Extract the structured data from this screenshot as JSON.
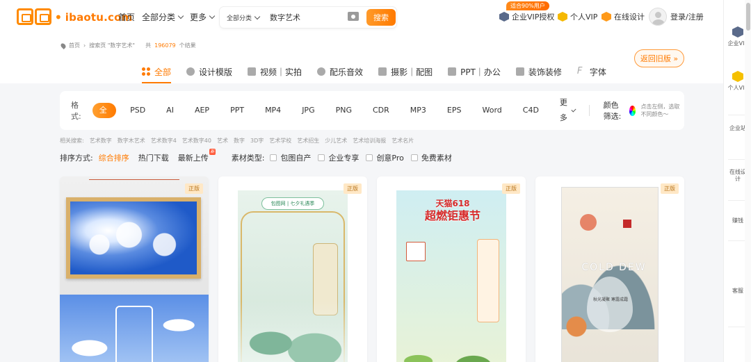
{
  "header": {
    "logo_text": "ibaotu.com",
    "nav": [
      "首页",
      "全部分类",
      "更多"
    ],
    "search_category": "全部分类",
    "search_value": "数字艺术",
    "search_button": "搜索",
    "promo": "适合90%用户",
    "enterprise_vip": "企业VIP授权",
    "personal_vip": "个人VIP",
    "online_design": "在线设计",
    "login": "登录/注册"
  },
  "breadcrumb": {
    "home": "首页",
    "search_page": "搜索页 \"数字艺术\"",
    "prefix": "共",
    "count": "196079",
    "suffix": "个结果"
  },
  "tabs": [
    {
      "label": "全部"
    },
    {
      "label": "设计模版"
    },
    {
      "label": "视频｜实拍"
    },
    {
      "label": "配乐音效"
    },
    {
      "label": "摄影｜配图"
    },
    {
      "label": "PPT｜办公"
    },
    {
      "label": "装饰装修"
    },
    {
      "label": "字体"
    }
  ],
  "old_version_button": "返回旧版 »",
  "filter": {
    "label": "格式:",
    "formats": [
      "全部",
      "PSD",
      "AI",
      "AEP",
      "PPT",
      "MP4",
      "JPG",
      "PNG",
      "CDR",
      "MP3",
      "EPS",
      "Word",
      "C4D",
      "更多"
    ],
    "color_label": "颜色筛选:",
    "color_hint": "点击左侧，选取不同颜色～"
  },
  "related": {
    "label": "相关搜索:",
    "items": [
      "艺术数字",
      "数字木艺术",
      "艺术数字4",
      "艺术数字40",
      "艺术",
      "数字",
      "3D字",
      "艺术学校",
      "艺术招生",
      "少儿艺术",
      "艺术培训海报",
      "艺术名片"
    ]
  },
  "sort": {
    "label": "排序方式:",
    "options": [
      "综合排序",
      "热门下载",
      "最新上传"
    ],
    "new_badge": "新",
    "type_label": "素材类型:",
    "types": [
      "包图自产",
      "企业专享",
      "创意Pro",
      "免费素材"
    ]
  },
  "cards": [
    {
      "badge": "正版"
    },
    {
      "badge": "正版",
      "art_title": "包图网 | 七夕礼遇季"
    },
    {
      "badge": "正版",
      "art_title_line1": "天猫618",
      "art_title_line2": "超燃钜惠节"
    },
    {
      "badge": "正版",
      "art_title": "COLD DEW",
      "art_subtitle": "秋光凝聚 寒露成霜"
    }
  ],
  "sidebar": {
    "items": [
      "企业VIP",
      "个人VIP",
      "企业站",
      "在线设计",
      "赚钱",
      "客服"
    ]
  },
  "colors": {
    "accent": "#ff7a00",
    "badge_bg": "#ffe8c6",
    "page_bg": "#f5f6f8"
  }
}
